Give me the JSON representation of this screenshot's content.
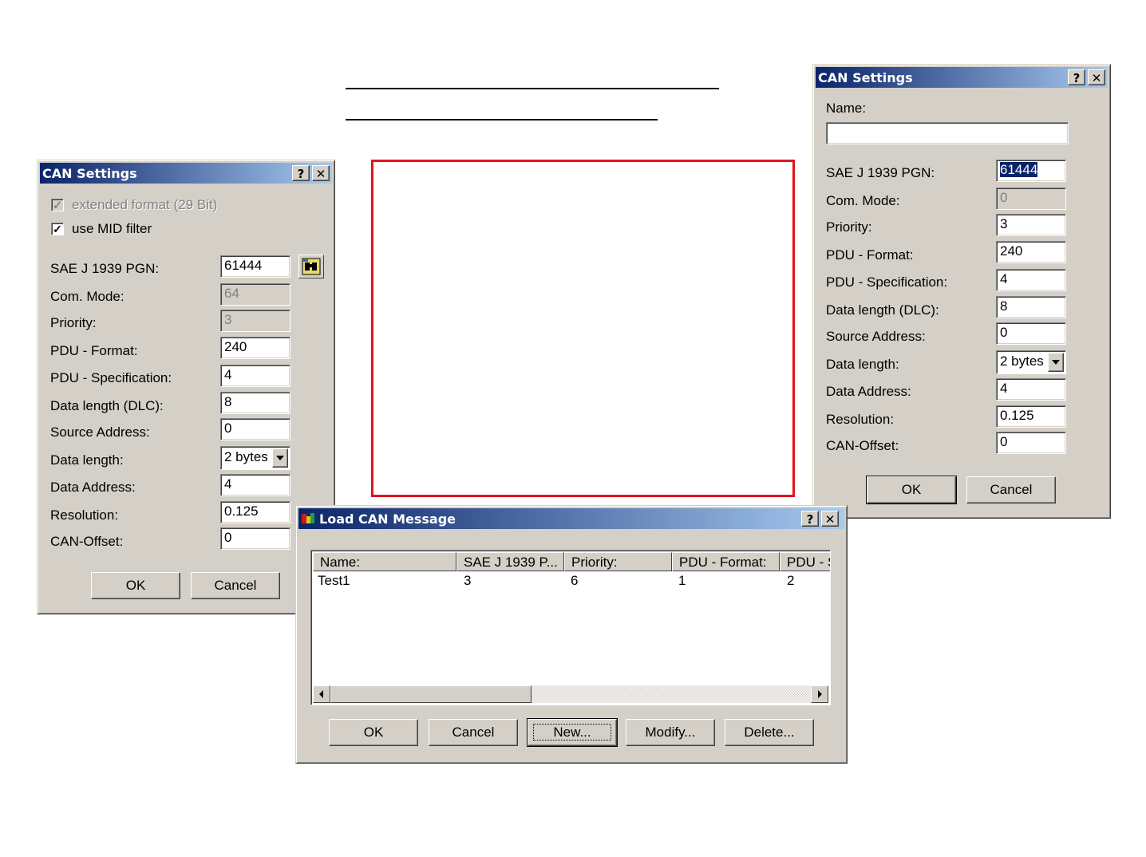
{
  "left_dialog": {
    "title": "CAN Settings",
    "help_label": "?",
    "close_label": "✕",
    "extended_format_label": "extended format (29 Bit)",
    "extended_format_checked": true,
    "mid_filter_label": "use MID filter",
    "mid_filter_checked": true,
    "fields": [
      {
        "label": "SAE J 1939 PGN:",
        "value": "61444"
      },
      {
        "label": "Com. Mode:",
        "value": "64"
      },
      {
        "label": "Priority:",
        "value": "3"
      },
      {
        "label": "PDU - Format:",
        "value": "240"
      },
      {
        "label": "PDU - Specification:",
        "value": "4"
      },
      {
        "label": "Data length (DLC):",
        "value": "8"
      },
      {
        "label": "Source Address:",
        "value": "0"
      },
      {
        "label": "Data length:",
        "value": "2 bytes"
      },
      {
        "label": "Data Address:",
        "value": "4"
      },
      {
        "label": "Resolution:",
        "value": "0.125"
      },
      {
        "label": "CAN-Offset:",
        "value": "0"
      }
    ],
    "ok_label": "OK",
    "cancel_label": "Cancel"
  },
  "right_dialog": {
    "title": "CAN Settings",
    "help_label": "?",
    "close_label": "✕",
    "name_label": "Name:",
    "name_value": "",
    "fields": [
      {
        "label": "SAE J 1939 PGN:",
        "value": "61444"
      },
      {
        "label": "Com. Mode:",
        "value": "0"
      },
      {
        "label": "Priority:",
        "value": "3"
      },
      {
        "label": "PDU - Format:",
        "value": "240"
      },
      {
        "label": "PDU - Specification:",
        "value": "4"
      },
      {
        "label": "Data length (DLC):",
        "value": "8"
      },
      {
        "label": "Source Address:",
        "value": "0"
      },
      {
        "label": "Data length:",
        "value": "2 bytes"
      },
      {
        "label": "Data Address:",
        "value": "4"
      },
      {
        "label": "Resolution:",
        "value": "0.125"
      },
      {
        "label": "CAN-Offset:",
        "value": "0"
      }
    ],
    "ok_label": "OK",
    "cancel_label": "Cancel"
  },
  "load_dialog": {
    "title": "Load CAN Message",
    "help_label": "?",
    "close_label": "✕",
    "columns": [
      "Name:",
      "SAE J 1939 P...",
      "Priority:",
      "PDU - Format:",
      "PDU - S"
    ],
    "rows": [
      [
        "Test1",
        "3",
        "6",
        "1",
        "2"
      ]
    ],
    "buttons": {
      "ok": "OK",
      "cancel": "Cancel",
      "new": "New...",
      "modify": "Modify...",
      "delete": "Delete..."
    }
  }
}
